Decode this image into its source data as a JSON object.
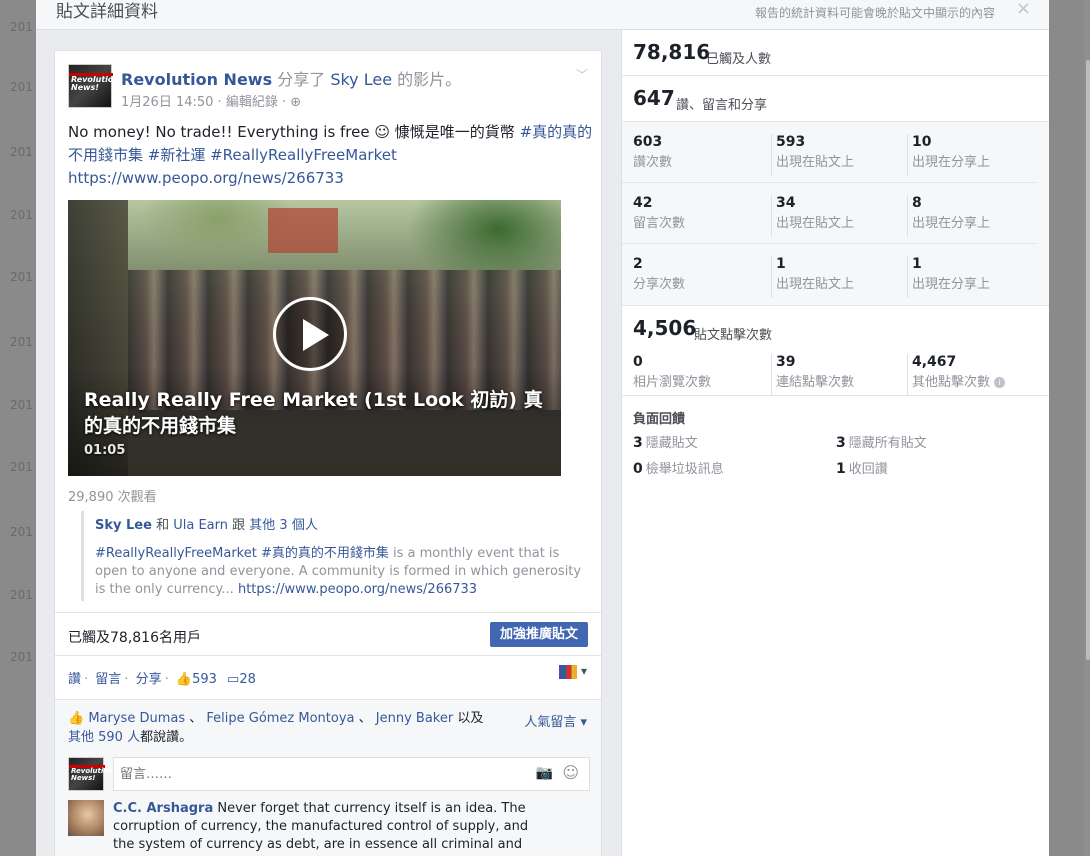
{
  "background_years": [
    "201",
    "201",
    "201",
    "201",
    "201",
    "201",
    "201",
    "201",
    "201",
    "201",
    "201"
  ],
  "dialog": {
    "title": "貼文詳細資料",
    "note": "報告的統計資料可能會晚於貼文中顯示的內容",
    "close": "×"
  },
  "post": {
    "avatar_text": "Revolution News!",
    "author": "Revolution News",
    "shared_verb": "分享了",
    "shared_person": "Sky Lee",
    "shared_suffix": "的影片。",
    "time": "1月26日 14:50",
    "edit_history": "編輯紀錄",
    "text_plain": "No money! No trade!! Everything is free ☺ 慷慨是唯一的貨幣",
    "text_tags": "#真的真的不用錢市集 #新社運 #ReallyReallyFreeMarket",
    "text_link": "https://www.peopo.org/news/266733",
    "video_title": "Really Really Free Market (1st Look 初訪) 真的真的不用錢市集",
    "video_duration": "01:05",
    "views": "29,890 次觀看",
    "shared_with_a": "Sky Lee",
    "shared_with_and": "和",
    "shared_with_b": "Ula Earn",
    "shared_with_with": "跟",
    "shared_with_others": "其他 3 個人",
    "shared_desc_tags": "#ReallyReallyFreeMarket #真的真的不用錢市集",
    "shared_desc": "is a monthly event that is open to anyone and everyone. A community is formed in which generosity is the only currency...",
    "shared_desc_link": "https://www.peopo.org/news/266733",
    "reached": "已觸及78,816名用戶",
    "boost": "加強推廣貼文",
    "like": "讚",
    "comment": "留言",
    "share": "分享",
    "like_count": "593",
    "comment_count": "28",
    "likers_1": "Maryse Dumas",
    "likers_2": "Felipe Gómez Montoya",
    "likers_3": "Jenny Baker",
    "likers_and": "以及",
    "likers_others": "其他 590 人",
    "likers_suffix": "都說讚。",
    "top_comments": "人氣留言",
    "comment_placeholder": "留言……",
    "comment1_author": "C.C. Arshagra",
    "comment1_text": "Never forget that currency itself is an idea. The corruption of currency, the manufactured control of supply, and the system of currency as debt, are in essence all criminal and"
  },
  "stats": {
    "reach_num": "78,816",
    "reach_lbl": "已觸及人數",
    "eng_num": "647",
    "eng_lbl": "讚、留言和分享",
    "rows": [
      {
        "a_n": "603",
        "a_t": "讚次數",
        "b_n": "593",
        "b_t": "出現在貼文上",
        "c_n": "10",
        "c_t": "出現在分享上"
      },
      {
        "a_n": "42",
        "a_t": "留言次數",
        "b_n": "34",
        "b_t": "出現在貼文上",
        "c_n": "8",
        "c_t": "出現在分享上"
      },
      {
        "a_n": "2",
        "a_t": "分享次數",
        "b_n": "1",
        "b_t": "出現在貼文上",
        "c_n": "1",
        "c_t": "出現在分享上"
      }
    ],
    "clicks_num": "4,506",
    "clicks_lbl": "貼文點擊次數",
    "photo_n": "0",
    "photo_t": "相片瀏覽次數",
    "link_n": "39",
    "link_t": "連結點擊次數",
    "other_n": "4,467",
    "other_t": "其他點擊次數",
    "neg_head": "負面回饋",
    "hide_post_n": "3",
    "hide_post_t": "隱藏貼文",
    "hide_all_n": "3",
    "hide_all_t": "隱藏所有貼文",
    "spam_n": "0",
    "spam_t": "檢舉垃圾訊息",
    "unlike_n": "1",
    "unlike_t": "收回讚"
  }
}
